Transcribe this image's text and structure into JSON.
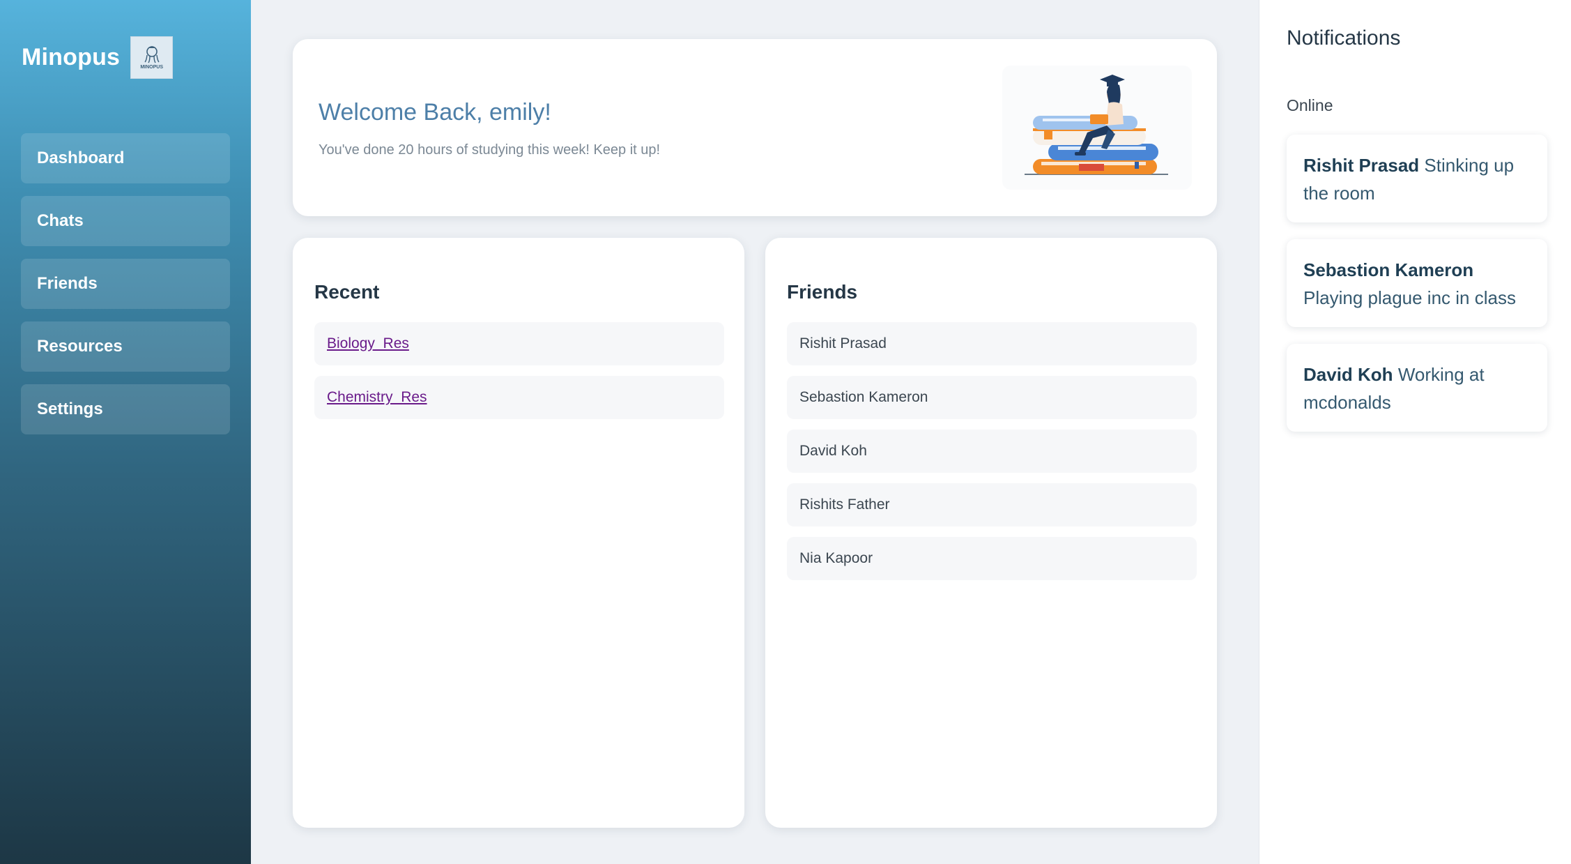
{
  "brand": {
    "name": "Minopus",
    "logo_text": "MINOPUS"
  },
  "sidebar": {
    "items": [
      {
        "label": "Dashboard"
      },
      {
        "label": "Chats"
      },
      {
        "label": "Friends"
      },
      {
        "label": "Resources"
      },
      {
        "label": "Settings"
      }
    ]
  },
  "welcome": {
    "title": "Welcome Back, emily!",
    "subtitle": "You've done 20 hours of studying this week! Keep it up!",
    "illustration": "student-reading-on-books-icon"
  },
  "recent": {
    "title": "Recent",
    "items": [
      {
        "label": "Biology_Res"
      },
      {
        "label": "Chemistry_Res"
      }
    ]
  },
  "friends": {
    "title": "Friends",
    "items": [
      {
        "name": "Rishit Prasad"
      },
      {
        "name": "Sebastion Kameron"
      },
      {
        "name": "David Koh"
      },
      {
        "name": "Rishits Father"
      },
      {
        "name": "Nia Kapoor"
      }
    ]
  },
  "notifications": {
    "title": "Notifications",
    "section": "Online",
    "items": [
      {
        "name": "Rishit Prasad",
        "status": "Stinking up the room"
      },
      {
        "name": "Sebastion Kameron",
        "status": "Playing plague inc in class"
      },
      {
        "name": "David Koh",
        "status": "Working at mcdonalds"
      }
    ]
  },
  "colors": {
    "sidebar_top": "#56b3dc",
    "sidebar_bottom": "#1d3745",
    "welcome_title": "#4d7fa8",
    "link": "#6a1b8a",
    "background": "#eef1f5"
  }
}
